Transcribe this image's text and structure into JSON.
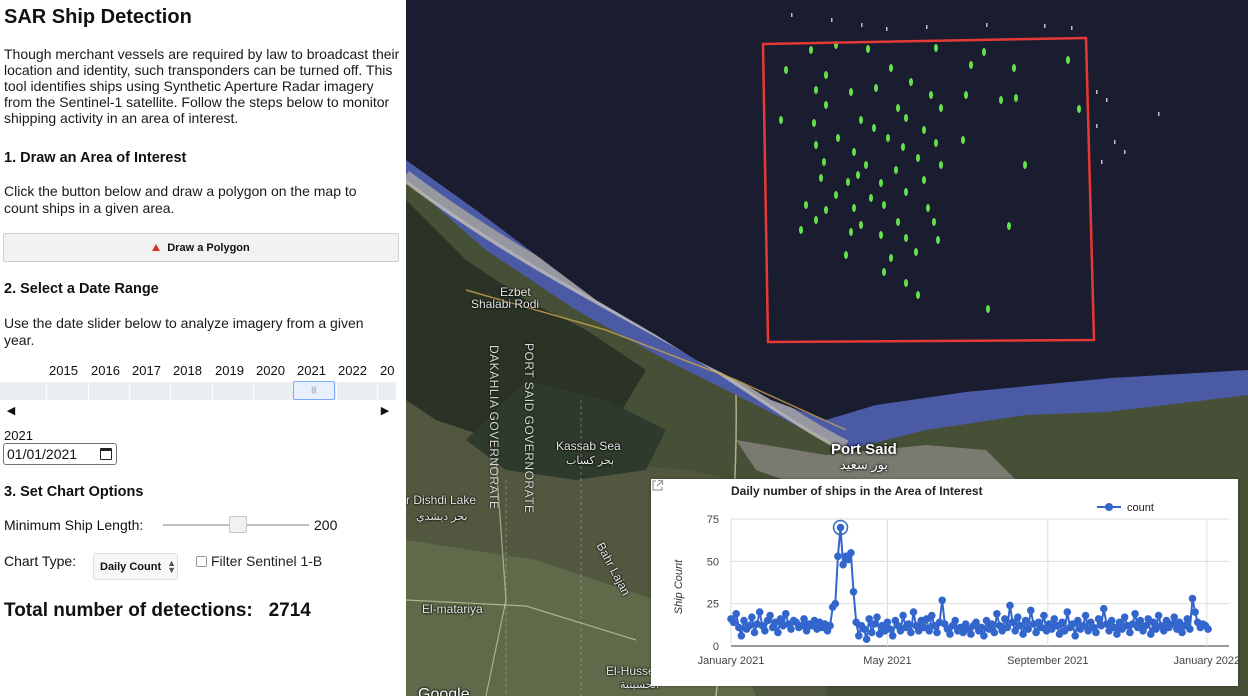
{
  "app": {
    "title": "SAR Ship Detection",
    "intro": "Though merchant vessels are required by law to broadcast their location and identity, such transponders can be turned off. This tool identifies ships using Synthetic Aperture Radar imagery from the Sentinel-1 satellite. Follow the steps below to monitor shipping activity in an area of interest."
  },
  "step1": {
    "heading": "1. Draw an Area of Interest",
    "text": "Click the button below and draw a polygon on the map to count ships in a given area.",
    "button_label": "Draw a Polygon"
  },
  "step2": {
    "heading": "2. Select a Date Range",
    "text": "Use the date slider below to analyze imagery from a given year.",
    "years": [
      "2015",
      "2016",
      "2017",
      "2018",
      "2019",
      "2020",
      "2021",
      "2022",
      "20"
    ],
    "selected_year": "2021",
    "date_value": "01/01/2021",
    "prev_arrow": "◀",
    "next_arrow": "▶"
  },
  "step3": {
    "heading": "3. Set Chart Options",
    "min_length_label": "Minimum Ship Length:",
    "min_length_value": "200",
    "chart_type_label": "Chart Type:",
    "chart_type_value": "Daily Count",
    "filter_label": "Filter Sentinel 1-B"
  },
  "total": {
    "label": "Total number of detections:",
    "value": "2714"
  },
  "map": {
    "labels": {
      "ezbet": "Ezbet",
      "shalabi": "Shalabi Rodi",
      "kassab": "Kassab Sea",
      "kassab_ar": "بحر كساب",
      "dishdi": "r Dishdi Lake",
      "dishdi_ar": "بحر ديشدي",
      "bahr_lajan": "Bahr Lajan",
      "el_matariya": "El-matariya",
      "el_husseinia": "El-Husse",
      "el_husseinia_ar": "الحسينية",
      "google": "Google",
      "dakahlia": "DAKAHLIA GOVERNORATE",
      "port_said_gov": "PORT SAID GOVERNORATE",
      "port_said": "Port Said",
      "port_said_ar": "بور سعيد"
    }
  },
  "chart_data": {
    "type": "line",
    "title": "Daily number of ships in the Area of Interest",
    "ylabel": "Ship Count",
    "xlabel": "",
    "ylim": [
      0,
      75
    ],
    "yticks": [
      0,
      25,
      50,
      75
    ],
    "xticks": [
      "January 2021",
      "May 2021",
      "September 2021",
      "January 2022"
    ],
    "legend": "top-right",
    "series": [
      {
        "name": "count",
        "color": "#3366cc",
        "points": [
          [
            "2021-01-01",
            16
          ],
          [
            "2021-01-03",
            14
          ],
          [
            "2021-01-05",
            19
          ],
          [
            "2021-01-07",
            11
          ],
          [
            "2021-01-09",
            6
          ],
          [
            "2021-01-11",
            15
          ],
          [
            "2021-01-13",
            10
          ],
          [
            "2021-01-15",
            12
          ],
          [
            "2021-01-17",
            17
          ],
          [
            "2021-01-19",
            8
          ],
          [
            "2021-01-21",
            13
          ],
          [
            "2021-01-23",
            20
          ],
          [
            "2021-01-25",
            12
          ],
          [
            "2021-01-27",
            9
          ],
          [
            "2021-01-29",
            15
          ],
          [
            "2021-01-31",
            18
          ],
          [
            "2021-02-02",
            11
          ],
          [
            "2021-02-04",
            14
          ],
          [
            "2021-02-06",
            8
          ],
          [
            "2021-02-08",
            16
          ],
          [
            "2021-02-10",
            12
          ],
          [
            "2021-02-12",
            19
          ],
          [
            "2021-02-14",
            13
          ],
          [
            "2021-02-16",
            10
          ],
          [
            "2021-02-18",
            15
          ],
          [
            "2021-02-20",
            14
          ],
          [
            "2021-02-22",
            11
          ],
          [
            "2021-02-24",
            12
          ],
          [
            "2021-02-26",
            16
          ],
          [
            "2021-02-28",
            9
          ],
          [
            "2021-03-02",
            13
          ],
          [
            "2021-03-04",
            12
          ],
          [
            "2021-03-06",
            15
          ],
          [
            "2021-03-08",
            10
          ],
          [
            "2021-03-10",
            14
          ],
          [
            "2021-03-12",
            11
          ],
          [
            "2021-03-14",
            13
          ],
          [
            "2021-03-16",
            9
          ],
          [
            "2021-03-18",
            12
          ],
          [
            "2021-03-20",
            23
          ],
          [
            "2021-03-22",
            25
          ],
          [
            "2021-03-24",
            53
          ],
          [
            "2021-03-26",
            70
          ],
          [
            "2021-03-28",
            48
          ],
          [
            "2021-03-30",
            53
          ],
          [
            "2021-04-01",
            51
          ],
          [
            "2021-04-03",
            55
          ],
          [
            "2021-04-05",
            32
          ],
          [
            "2021-04-07",
            14
          ],
          [
            "2021-04-09",
            6
          ],
          [
            "2021-04-11",
            12
          ],
          [
            "2021-04-13",
            10
          ],
          [
            "2021-04-15",
            4
          ],
          [
            "2021-04-17",
            16
          ],
          [
            "2021-04-19",
            8
          ],
          [
            "2021-04-21",
            13
          ],
          [
            "2021-04-23",
            17
          ],
          [
            "2021-04-25",
            7
          ],
          [
            "2021-04-27",
            12
          ],
          [
            "2021-04-29",
            9
          ],
          [
            "2021-05-01",
            14
          ],
          [
            "2021-05-03",
            10
          ],
          [
            "2021-05-05",
            6
          ],
          [
            "2021-05-07",
            15
          ],
          [
            "2021-05-09",
            12
          ],
          [
            "2021-05-11",
            9
          ],
          [
            "2021-05-13",
            18
          ],
          [
            "2021-05-15",
            11
          ],
          [
            "2021-05-17",
            13
          ],
          [
            "2021-05-19",
            8
          ],
          [
            "2021-05-21",
            20
          ],
          [
            "2021-05-23",
            12
          ],
          [
            "2021-05-25",
            9
          ],
          [
            "2021-05-27",
            15
          ],
          [
            "2021-05-29",
            11
          ],
          [
            "2021-05-31",
            16
          ],
          [
            "2021-06-02",
            9
          ],
          [
            "2021-06-04",
            18
          ],
          [
            "2021-06-06",
            12
          ],
          [
            "2021-06-08",
            8
          ],
          [
            "2021-06-10",
            14
          ],
          [
            "2021-06-12",
            27
          ],
          [
            "2021-06-14",
            13
          ],
          [
            "2021-06-16",
            10
          ],
          [
            "2021-06-18",
            7
          ],
          [
            "2021-06-20",
            12
          ],
          [
            "2021-06-22",
            15
          ],
          [
            "2021-06-24",
            9
          ],
          [
            "2021-06-26",
            11
          ],
          [
            "2021-06-28",
            8
          ],
          [
            "2021-06-30",
            13
          ],
          [
            "2021-07-02",
            10
          ],
          [
            "2021-07-04",
            7
          ],
          [
            "2021-07-06",
            12
          ],
          [
            "2021-07-08",
            14
          ],
          [
            "2021-07-10",
            9
          ],
          [
            "2021-07-12",
            11
          ],
          [
            "2021-07-14",
            6
          ],
          [
            "2021-07-16",
            15
          ],
          [
            "2021-07-18",
            10
          ],
          [
            "2021-07-20",
            13
          ],
          [
            "2021-07-22",
            8
          ],
          [
            "2021-07-24",
            19
          ],
          [
            "2021-07-26",
            12
          ],
          [
            "2021-07-28",
            9
          ],
          [
            "2021-07-30",
            16
          ],
          [
            "2021-08-01",
            11
          ],
          [
            "2021-08-03",
            24
          ],
          [
            "2021-08-05",
            14
          ],
          [
            "2021-08-07",
            9
          ],
          [
            "2021-08-09",
            17
          ],
          [
            "2021-08-11",
            12
          ],
          [
            "2021-08-13",
            7
          ],
          [
            "2021-08-15",
            15
          ],
          [
            "2021-08-17",
            10
          ],
          [
            "2021-08-19",
            21
          ],
          [
            "2021-08-21",
            13
          ],
          [
            "2021-08-23",
            8
          ],
          [
            "2021-08-25",
            14
          ],
          [
            "2021-08-27",
            11
          ],
          [
            "2021-08-29",
            18
          ],
          [
            "2021-08-31",
            9
          ],
          [
            "2021-09-02",
            13
          ],
          [
            "2021-09-04",
            10
          ],
          [
            "2021-09-06",
            16
          ],
          [
            "2021-09-08",
            12
          ],
          [
            "2021-09-10",
            7
          ],
          [
            "2021-09-12",
            14
          ],
          [
            "2021-09-14",
            9
          ],
          [
            "2021-09-16",
            20
          ],
          [
            "2021-09-18",
            11
          ],
          [
            "2021-09-20",
            13
          ],
          [
            "2021-09-22",
            6
          ],
          [
            "2021-09-24",
            15
          ],
          [
            "2021-09-26",
            10
          ],
          [
            "2021-09-28",
            12
          ],
          [
            "2021-09-30",
            18
          ],
          [
            "2021-10-02",
            9
          ],
          [
            "2021-10-04",
            14
          ],
          [
            "2021-10-06",
            11
          ],
          [
            "2021-10-08",
            8
          ],
          [
            "2021-10-10",
            16
          ],
          [
            "2021-10-12",
            12
          ],
          [
            "2021-10-14",
            22
          ],
          [
            "2021-10-16",
            13
          ],
          [
            "2021-10-18",
            9
          ],
          [
            "2021-10-20",
            15
          ],
          [
            "2021-10-22",
            11
          ],
          [
            "2021-10-24",
            7
          ],
          [
            "2021-10-26",
            14
          ],
          [
            "2021-10-28",
            10
          ],
          [
            "2021-10-30",
            17
          ],
          [
            "2021-11-01",
            12
          ],
          [
            "2021-11-03",
            8
          ],
          [
            "2021-11-05",
            13
          ],
          [
            "2021-11-07",
            19
          ],
          [
            "2021-11-09",
            11
          ],
          [
            "2021-11-11",
            15
          ],
          [
            "2021-11-13",
            9
          ],
          [
            "2021-11-15",
            12
          ],
          [
            "2021-11-17",
            16
          ],
          [
            "2021-11-19",
            7
          ],
          [
            "2021-11-21",
            14
          ],
          [
            "2021-11-23",
            10
          ],
          [
            "2021-11-25",
            18
          ],
          [
            "2021-11-27",
            12
          ],
          [
            "2021-11-29",
            9
          ],
          [
            "2021-12-01",
            15
          ],
          [
            "2021-12-03",
            11
          ],
          [
            "2021-12-05",
            13
          ],
          [
            "2021-12-07",
            17
          ],
          [
            "2021-12-09",
            10
          ],
          [
            "2021-12-11",
            14
          ],
          [
            "2021-12-13",
            8
          ],
          [
            "2021-12-15",
            12
          ],
          [
            "2021-12-17",
            16
          ],
          [
            "2021-12-19",
            10
          ],
          [
            "2021-12-21",
            28
          ],
          [
            "2021-12-23",
            20
          ],
          [
            "2021-12-25",
            14
          ],
          [
            "2021-12-27",
            11
          ],
          [
            "2021-12-29",
            13
          ],
          [
            "2021-12-31",
            12
          ],
          [
            "2022-01-02",
            10
          ]
        ]
      }
    ],
    "highlight": [
      "2021-03-26",
      70
    ]
  }
}
